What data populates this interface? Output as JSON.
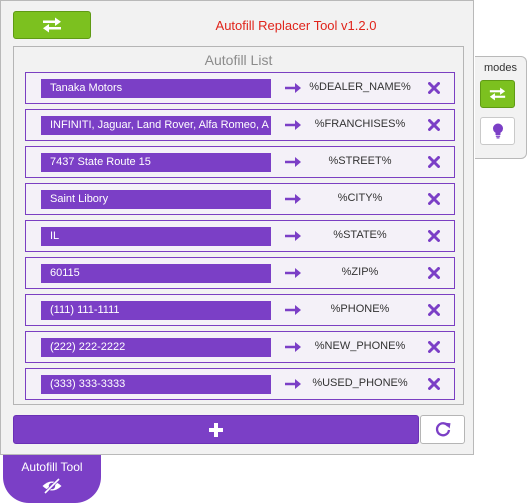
{
  "header": {
    "title": "Autofill Replacer Tool v1.2.0",
    "swap_icon": "swap-arrows-icon"
  },
  "list": {
    "heading": "Autofill List",
    "rows": [
      {
        "value": "Tanaka Motors",
        "placeholder_tag": "%DEALER_NAME%"
      },
      {
        "value": "INFINITI, Jaguar, Land Rover, Alfa Romeo, A",
        "placeholder_tag": "%FRANCHISES%"
      },
      {
        "value": "7437 State Route 15",
        "placeholder_tag": "%STREET%"
      },
      {
        "value": "Saint Libory",
        "placeholder_tag": "%CITY%"
      },
      {
        "value": "IL",
        "placeholder_tag": "%STATE%"
      },
      {
        "value": "60115",
        "placeholder_tag": "%ZIP%"
      },
      {
        "value": "(111) 111-1111",
        "placeholder_tag": "%PHONE%"
      },
      {
        "value": "(222) 222-2222",
        "placeholder_tag": "%NEW_PHONE%"
      },
      {
        "value": "(333) 333-3333",
        "placeholder_tag": "%USED_PHONE%"
      }
    ]
  },
  "actions": {
    "add_icon": "plus-icon",
    "reset_icon": "refresh-icon"
  },
  "modes": {
    "label": "modes",
    "items": [
      "swap-arrows-icon",
      "lightbulb-icon"
    ]
  },
  "tab": {
    "label": "Autofill Tool",
    "icon": "eye-slash-icon"
  },
  "colors": {
    "accent_purple": "#7b3fc6",
    "accent_green": "#7cc11f",
    "title_red": "#e0241b"
  }
}
